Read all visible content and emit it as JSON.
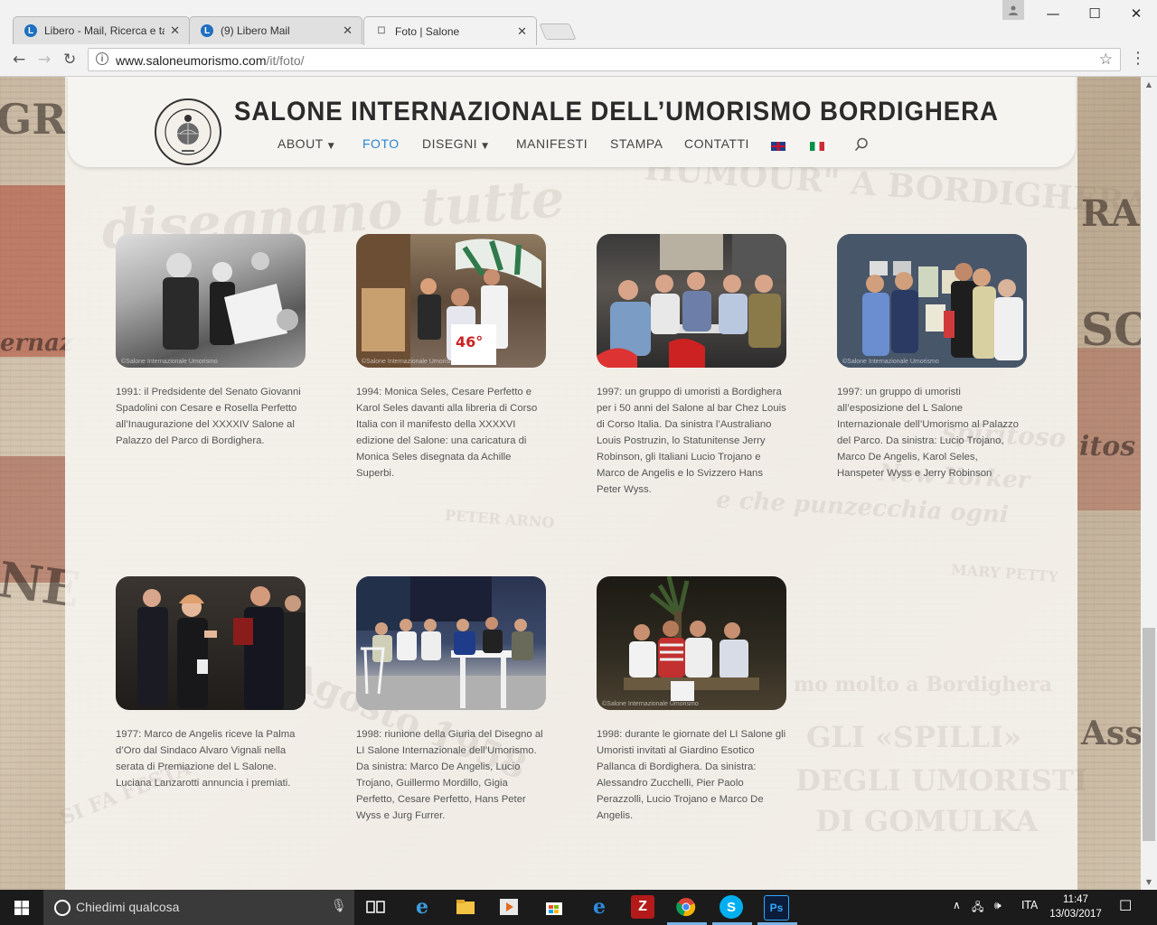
{
  "browser": {
    "tabs": [
      {
        "title": "Libero - Mail, Ricerca e ta",
        "favicon": "libero-icon",
        "active": false
      },
      {
        "title": "(9) Libero Mail",
        "favicon": "libero-icon",
        "active": false
      },
      {
        "title": "Foto | Salone",
        "favicon": "page-icon",
        "active": true
      }
    ],
    "url_host": "www.saloneumorismo.com",
    "url_path": "/it/foto/"
  },
  "site": {
    "title": "SALONE INTERNAZIONALE DELL’UMORISMO BORDIGHERA",
    "logo_text": "Salone Internazionale Umorismo Bordighera",
    "nav": [
      {
        "label": "ABOUT",
        "has_dropdown": true,
        "active": false
      },
      {
        "label": "FOTO",
        "has_dropdown": false,
        "active": true
      },
      {
        "label": "DISEGNI",
        "has_dropdown": true,
        "active": false
      },
      {
        "label": "MANIFESTI",
        "has_dropdown": false,
        "active": false
      },
      {
        "label": "STAMPA",
        "has_dropdown": false,
        "active": false
      },
      {
        "label": "CONTATTI",
        "has_dropdown": false,
        "active": false
      }
    ],
    "accent_color": "#2b86cf"
  },
  "background_text": {
    "mid_1": "HUMOUR\" A BORDIGHERA",
    "mid_2": "disegnano tutte",
    "mid_3": "spiritoso",
    "mid_4": "New Yorker",
    "mid_5": "e che punzecchia ogni",
    "mid_6": "PETER ARNO",
    "mid_7": "MARY PETTY",
    "mid_8": "mo molto a Bordighera",
    "mid_9": "GLI «SPILLI»",
    "mid_10": "DEGLI UMORISTI",
    "mid_11": "DI GOMULKA",
    "mid_12": "Agosto 1958",
    "mid_13": "SI FA FESTA",
    "left_1": "GR",
    "left_2": "NE",
    "left_3": "ernaz",
    "right_1": "RA",
    "right_2": "SO",
    "right_3": "itos",
    "right_4": "Ass"
  },
  "gallery": [
    {
      "caption": "1991: il Predsidente del Senato Giovanni Spadolini con Cesare e Rosella Perfetto all’Inaugurazione del XXXXIV Salone al Palazzo del Parco di Bordighera.",
      "watermark": "©Salone Internazionale Umorismo",
      "photo_style": "bw"
    },
    {
      "caption": "1994: Monica Seles, Cesare Perfetto e Karol Seles davanti alla libreria di Corso Italia con il manifesto della XXXXVI edizione del Salone: una caricatura di Monica Seles disegnata da Achille Superbi.",
      "watermark": "©Salone Internazionale Umorismo",
      "photo_style": "street"
    },
    {
      "caption": "1997: un gruppo di umoristi a Bordighera per i 50 anni del Salone al bar Chez Louis di Corso Italia. Da sinistra l’Australiano Louis Postruzin, lo Statunitense Jerry Robinson, gli Italiani Lucio Trojano e Marco de Angelis e lo Svizzero Hans Peter Wyss.",
      "watermark": "",
      "photo_style": "bar"
    },
    {
      "caption": "1997: un gruppo di umoristi all’esposizione del L Salone Internazionale dell’Umorismo al Palazzo del Parco. Da sinistra: Lucio Trojano, Marco De Angelis, Karol Seles, Hanspeter Wyss e Jerry Robinson",
      "watermark": "©Salone Internazionale Umorismo",
      "photo_style": "gallery"
    },
    {
      "caption": "1977: Marco de Angelis riceve la Palma d’Oro dal Sindaco Alvaro Vignali nella serata di Premiazione del L Salone. Luciana Lanzarotti annuncia i premiati.",
      "watermark": "",
      "photo_style": "award"
    },
    {
      "caption": "1998: riunione della Giuria del Disegno al LI Salone Internazionale dell’Umorismo. Da sinistra: Marco De Angelis, Lucio Trojano, Guillermo Mordillo, Gigia Perfetto, Cesare Perfetto, Hans Peter Wyss e Jurg Furrer.",
      "watermark": "",
      "photo_style": "jury"
    },
    {
      "caption": "1998: durante le giornate del LI Salone gli Umoristi invitati al Giardino Esotico Pallanca di Bordighera. Da sinistra: Alessandro Zucchelli, Pier Paolo Perazzolli, Lucio Trojano e Marco De Angelis.",
      "watermark": "©Salone Internazionale Umorismo",
      "photo_style": "garden"
    }
  ],
  "taskbar": {
    "search_placeholder": "Chiedimi qualcosa",
    "language": "ITA",
    "time": "11:47",
    "date": "13/03/2017"
  }
}
